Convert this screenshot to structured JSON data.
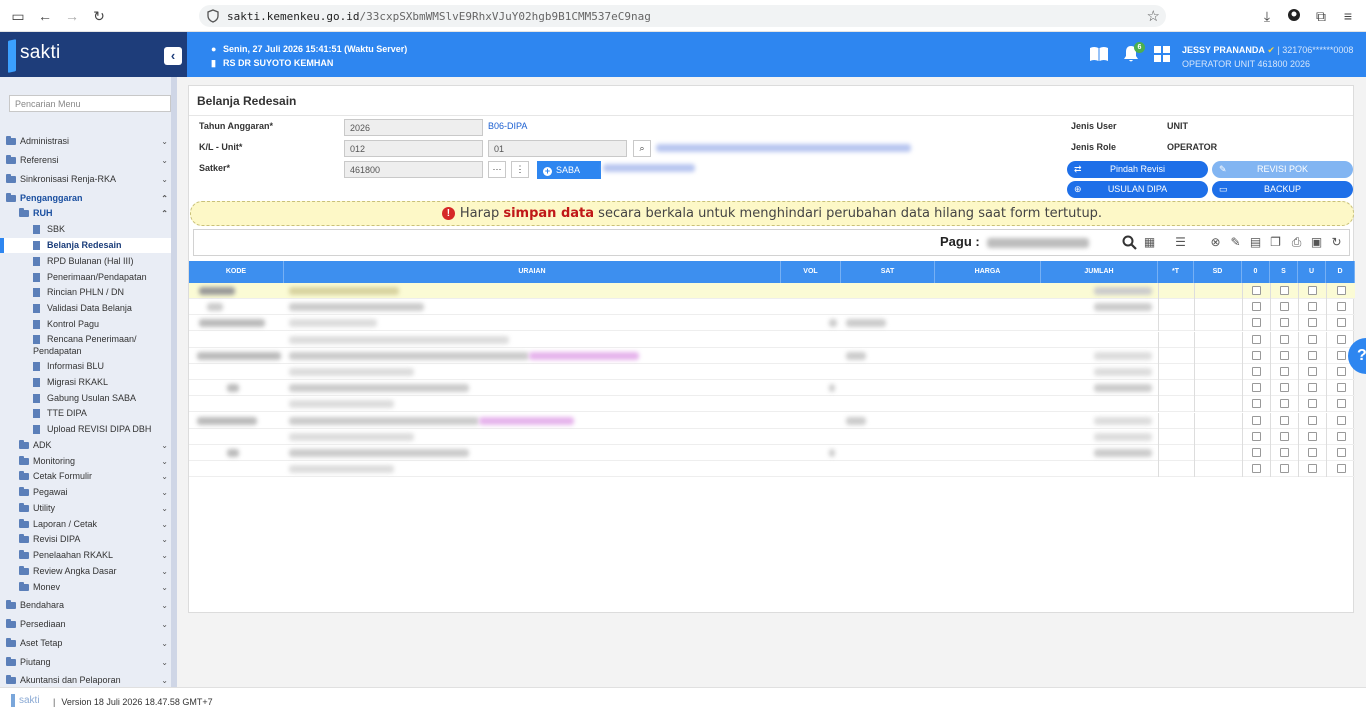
{
  "browser": {
    "url_domain": "sakti.kemenkeu.go.id",
    "url_path": "/33cxpSXbmWMSlvE9RhxVJuY02hgb9B1CMM537eC9nag"
  },
  "header": {
    "logo": "sakti",
    "server_time": "Senin, 27 Juli 2026 15:41:51 (Waktu Server)",
    "unit_name": "RS DR SUYOTO KEMHAN",
    "notification_count": "6",
    "user_name": "JESSY PRANANDA",
    "user_id": "| 321706******0008",
    "user_role": "OPERATOR UNIT 461800 2026"
  },
  "sidebar": {
    "search_placeholder": "Pencarian Menu",
    "items": [
      {
        "label": "Administrasi"
      },
      {
        "label": "Referensi"
      },
      {
        "label": "Sinkronisasi Renja-RKA"
      },
      {
        "label": "Penganggaran"
      },
      {
        "label": "RUH"
      },
      {
        "label": "SBK"
      },
      {
        "label": "Belanja Redesain"
      },
      {
        "label": "RPD Bulanan (Hal III)"
      },
      {
        "label": "Penerimaan/Pendapatan"
      },
      {
        "label": "Rincian PHLN / DN"
      },
      {
        "label": "Validasi Data Belanja"
      },
      {
        "label": "Kontrol Pagu"
      },
      {
        "label": "Rencana Penerimaan/"
      },
      {
        "label": "Pendapatan"
      },
      {
        "label": "Informasi BLU"
      },
      {
        "label": "Migrasi RKAKL"
      },
      {
        "label": "Gabung Usulan SABA"
      },
      {
        "label": "TTE DIPA"
      },
      {
        "label": "Upload REVISI DIPA DBH"
      },
      {
        "label": "ADK"
      },
      {
        "label": "Monitoring"
      },
      {
        "label": "Cetak Formulir"
      },
      {
        "label": "Pegawai"
      },
      {
        "label": "Utility"
      },
      {
        "label": "Laporan / Cetak"
      },
      {
        "label": "Revisi DIPA"
      },
      {
        "label": "Penelaahan RKAKL"
      },
      {
        "label": "Review Angka Dasar"
      },
      {
        "label": "Monev"
      },
      {
        "label": "Bendahara"
      },
      {
        "label": "Persediaan"
      },
      {
        "label": "Aset Tetap"
      },
      {
        "label": "Piutang"
      },
      {
        "label": "Akuntansi dan Pelaporan"
      }
    ]
  },
  "page": {
    "title": "Belanja Redesain",
    "tahun_label": "Tahun Anggaran*",
    "tahun_value": "2026",
    "dipa_link": "B06-DIPA",
    "kl_label": "K/L - Unit*",
    "kl_value": "012",
    "unit_value": "01",
    "satker_label": "Satker*",
    "satker_value": "461800",
    "saba_label": "SABA",
    "jenis_user_label": "Jenis User",
    "jenis_user_value": "UNIT",
    "jenis_role_label": "Jenis Role",
    "jenis_role_value": "OPERATOR",
    "btn_pindah_revisi": "Pindah Revisi",
    "btn_revisi_pok": "REVISI POK",
    "btn_usulan_dipa": "USULAN DIPA",
    "btn_backup": "BACKUP",
    "alert_pre": "Harap",
    "alert_em": "simpan data",
    "alert_post": "secara berkala untuk menghindari perubahan data hilang saat form tertutup.",
    "pagu_label": "Pagu :"
  },
  "table": {
    "headers": [
      "KODE",
      "URAIAN",
      "VOL",
      "SAT",
      "HARGA",
      "JUMLAH",
      "*T",
      "SD",
      "0",
      "S",
      "U",
      "D"
    ],
    "row_count": 12
  },
  "footer": {
    "logo": "sakti",
    "version": "Version 18 Juli 2026 18.47.58 GMT+7"
  },
  "colors": {
    "header_blue": "#2e86f0",
    "brand_navy": "#1e3d7a",
    "alert_bg": "#fdf8c7",
    "alert_emphasis": "#c01818"
  }
}
